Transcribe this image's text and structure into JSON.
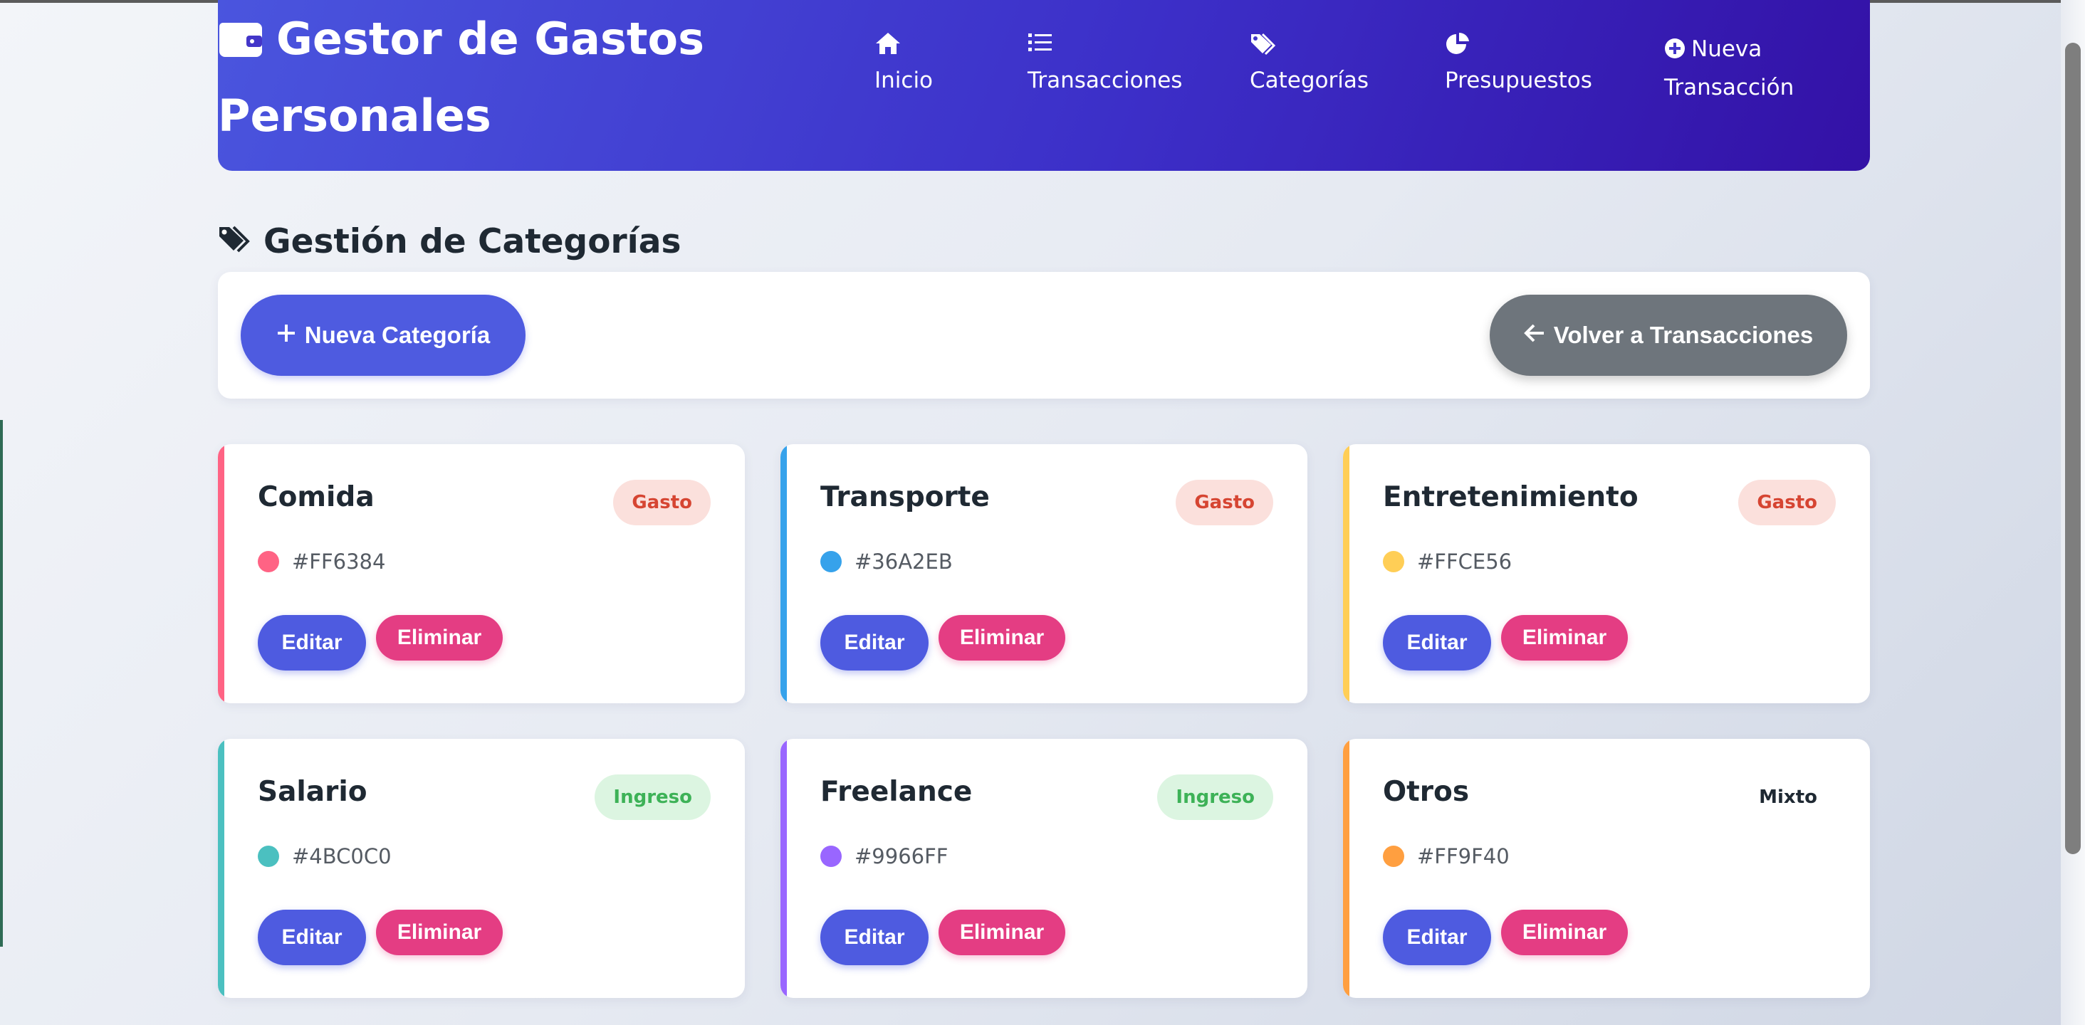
{
  "app": {
    "brand_line1": "Gestor de Gastos",
    "brand_line2": "Personales"
  },
  "nav": [
    {
      "label": "Inicio",
      "icon": "home-icon"
    },
    {
      "label": "Transacciones",
      "icon": "list-icon"
    },
    {
      "label": "Categorías",
      "icon": "tags-icon"
    },
    {
      "label": "Presupuestos",
      "icon": "pie-chart-icon"
    },
    {
      "label_line1": "Nueva",
      "label_line2": "Transacción",
      "icon": "plus-circle-icon"
    }
  ],
  "page": {
    "title": "Gestión de Categorías",
    "new_category_label": "Nueva Categoría",
    "back_label": "Volver a Transacciones"
  },
  "cards": [
    {
      "name": "Comida",
      "type": "Gasto",
      "color": "#FF6384"
    },
    {
      "name": "Transporte",
      "type": "Gasto",
      "color": "#36A2EB"
    },
    {
      "name": "Entretenimiento",
      "type": "Gasto",
      "color": "#FFCE56"
    },
    {
      "name": "Salario",
      "type": "Ingreso",
      "color": "#4BC0C0"
    },
    {
      "name": "Freelance",
      "type": "Ingreso",
      "color": "#9966FF"
    },
    {
      "name": "Otros",
      "type": "Mixto",
      "color": "#FF9F40"
    }
  ],
  "actions": {
    "edit_label": "Editar",
    "delete_label": "Eliminar"
  },
  "colors": {
    "header_start": "#4a55de",
    "header_end": "#3311a6",
    "primary": "#4e5be0",
    "danger": "#e43d83",
    "secondary": "#6e757c"
  }
}
